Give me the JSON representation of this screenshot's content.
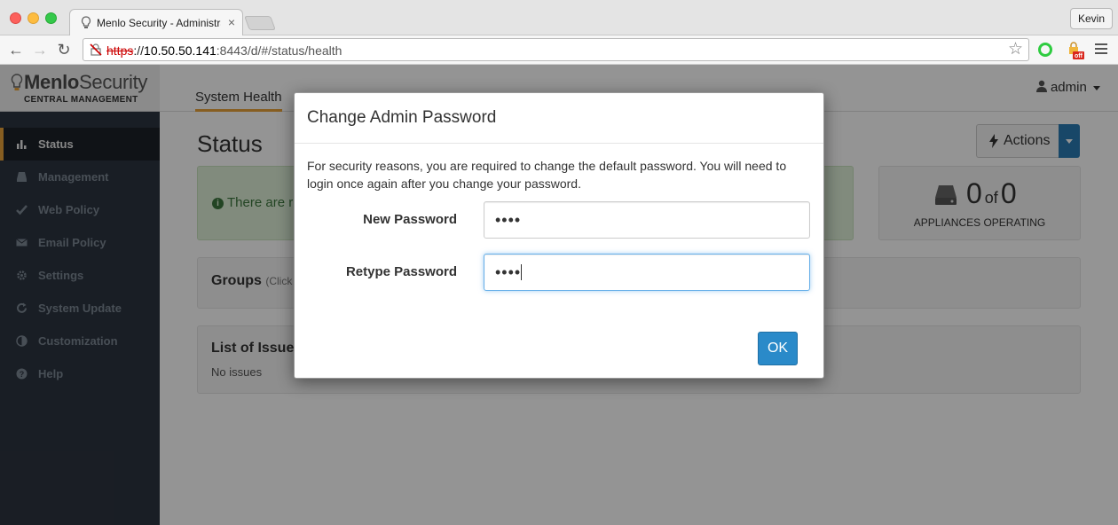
{
  "browser": {
    "tab_title": "Menlo Security - Administra",
    "tab_close": "×",
    "profile_name": "Kevin",
    "url_scheme": "https",
    "url_sep": "://",
    "url_host": "10.50.50.141",
    "url_rest": ":8443/d/#/status/health",
    "extension_badge": "off"
  },
  "sidebar": {
    "logo_main": "Menlo",
    "logo_second": "Security",
    "logo_sub": "CENTRAL MANAGEMENT",
    "items": [
      {
        "label": "Status",
        "icon": "bar-chart-icon",
        "active": true
      },
      {
        "label": "Management",
        "icon": "drive-icon"
      },
      {
        "label": "Web Policy",
        "icon": "checkmark-icon"
      },
      {
        "label": "Email Policy",
        "icon": "envelope-icon"
      },
      {
        "label": "Settings",
        "icon": "gear-icon"
      },
      {
        "label": "System Update",
        "icon": "refresh-icon"
      },
      {
        "label": "Customization",
        "icon": "contrast-icon"
      },
      {
        "label": "Help",
        "icon": "question-icon"
      }
    ]
  },
  "header": {
    "active_tab": "System Health",
    "user": "admin"
  },
  "main": {
    "title": "Status",
    "actions_label": "Actions",
    "alert_text": "There are r",
    "appliances_operating": "0",
    "appliances_of": "of",
    "appliances_total": "0",
    "appliances_label": "APPLIANCES OPERATING",
    "groups_title": "Groups",
    "groups_hint": "(Click",
    "issues_title": "List of Issues",
    "issues_text": "No issues"
  },
  "modal": {
    "title": "Change Admin Password",
    "message": "For security reasons, you are required to change the default password. You will need to login once again after you change your password.",
    "new_password_label": "New Password",
    "new_password_value": "••••",
    "retype_password_label": "Retype Password",
    "retype_password_value": "••••",
    "ok_label": "OK"
  }
}
